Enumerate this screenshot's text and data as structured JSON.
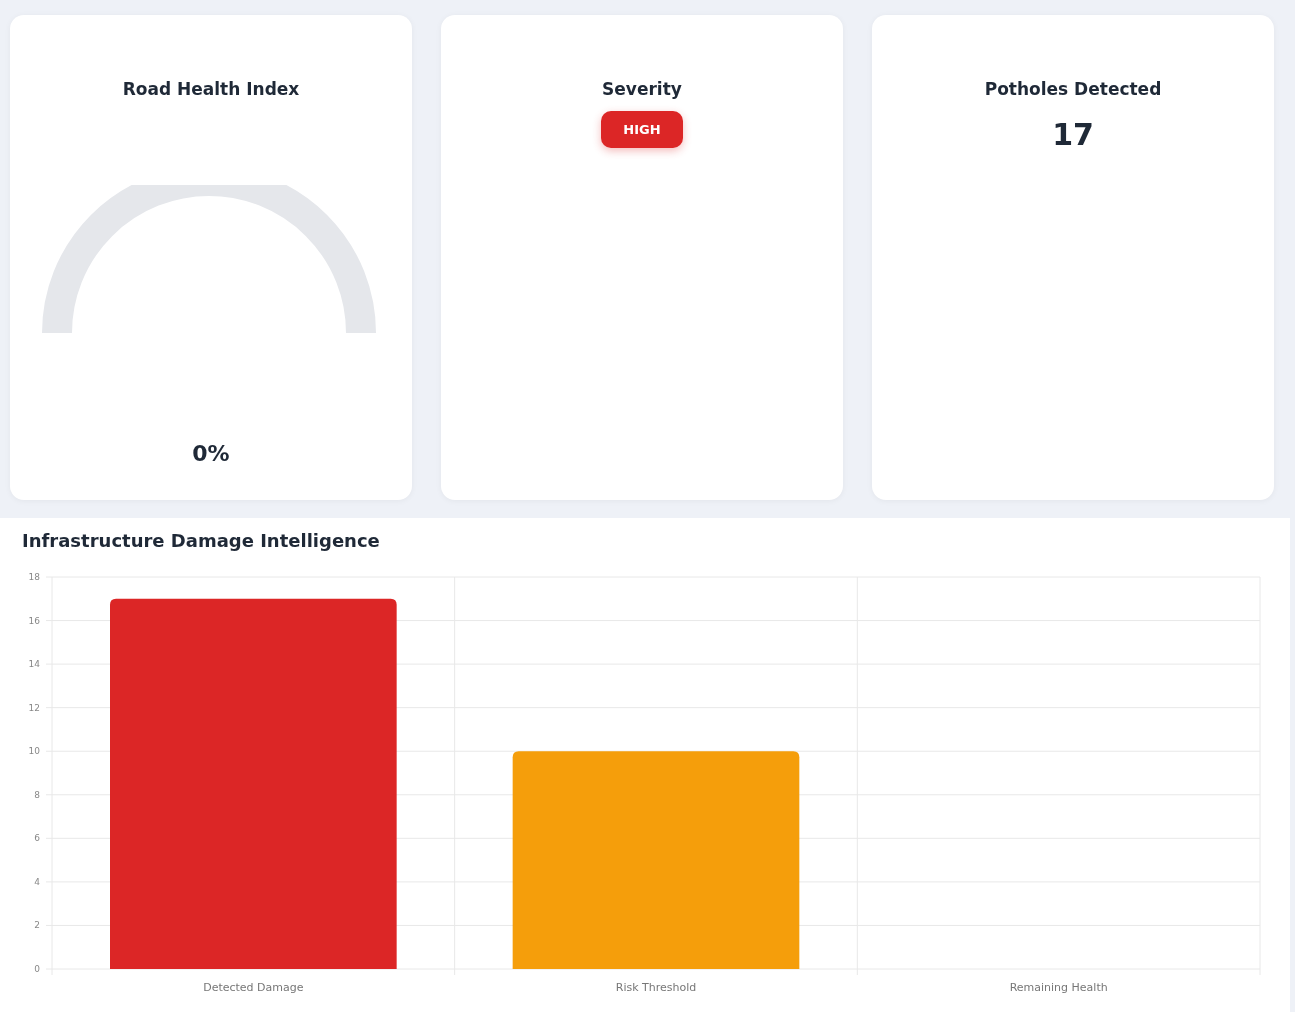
{
  "cards": [
    {
      "kind": "gauge",
      "title": "Road Health Index",
      "reading": "0%"
    },
    {
      "kind": "badge",
      "title": "Severity",
      "badge": {
        "label": "HIGH",
        "color": "#dc2626"
      }
    },
    {
      "kind": "count",
      "title": "Potholes Detected",
      "value": "17"
    }
  ],
  "damage_panel": {
    "title": "Infrastructure Damage Intelligence",
    "chart_data": {
      "type": "bar",
      "categories": [
        "Detected Damage",
        "Risk Threshold",
        "Remaining Health"
      ],
      "values": [
        17,
        10,
        0
      ],
      "grid": true,
      "ylim": [
        0,
        18
      ],
      "yticks": [
        0,
        2,
        4,
        6,
        8,
        10,
        12,
        14,
        16,
        18
      ]
    }
  }
}
